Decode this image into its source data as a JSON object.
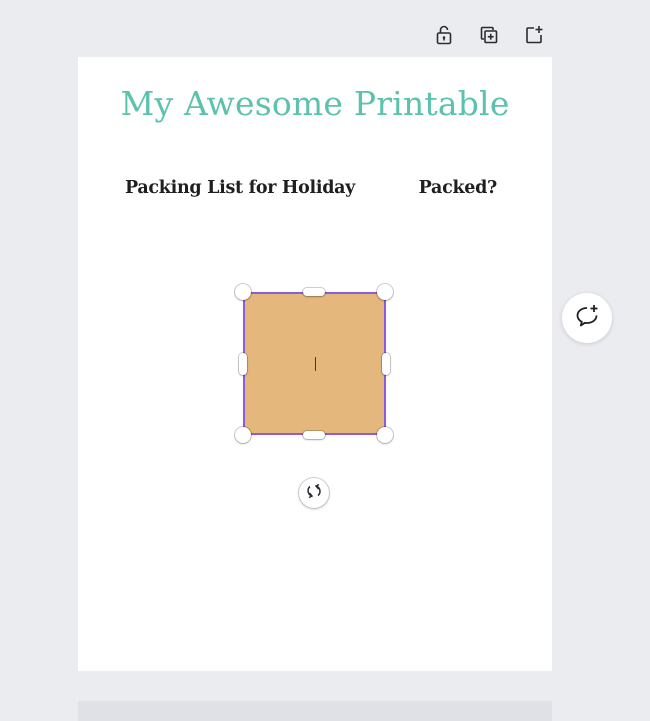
{
  "toolbar": {
    "lock_icon": "lock-open-icon",
    "duplicate_icon": "duplicate-page-icon",
    "add_page_icon": "add-page-icon"
  },
  "page": {
    "title": "My Awesome Printable",
    "heading_left": "Packing List for Holiday",
    "heading_right": "Packed?"
  },
  "selection": {
    "fill_color": "#e4b77c",
    "border_color": "#8b5cdc"
  },
  "comment": {
    "icon": "add-comment-icon"
  },
  "rotate": {
    "icon": "rotate-icon"
  },
  "colors": {
    "title": "#5cc2ad",
    "background": "#ebecf0"
  }
}
